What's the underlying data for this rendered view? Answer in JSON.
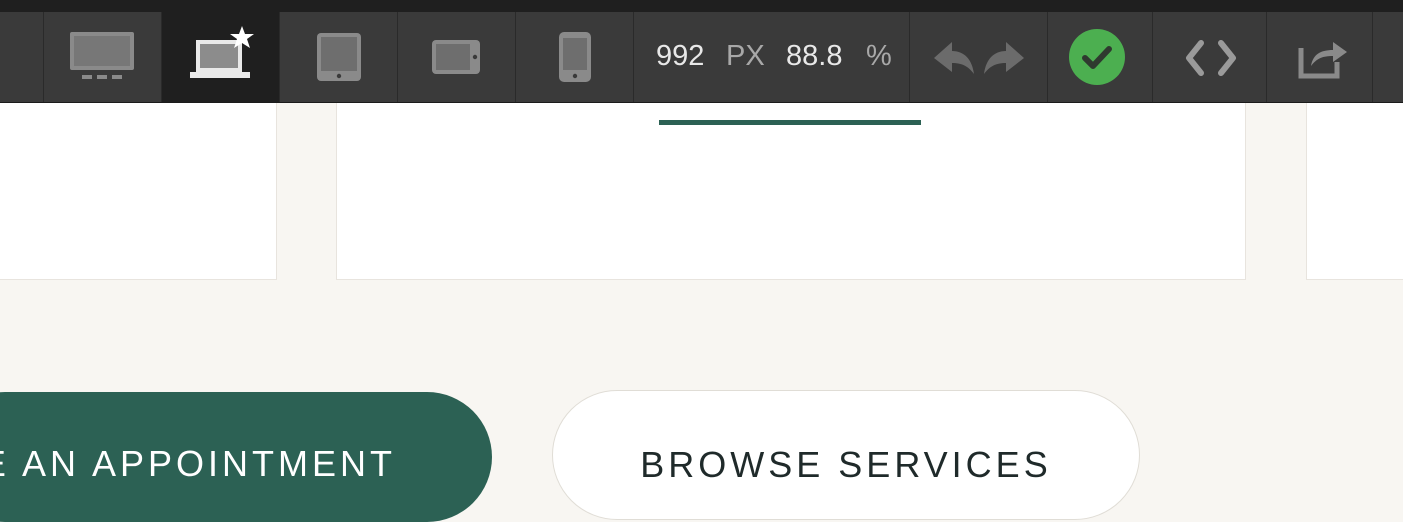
{
  "toolbar": {
    "width_value": "992",
    "width_unit": "PX",
    "zoom_value": "88.8",
    "zoom_unit": "%",
    "status_color": "#4caf50",
    "icons": [
      "desktop-icon",
      "laptop-star-icon",
      "tablet-portrait-icon",
      "tablet-landscape-icon",
      "phone-icon",
      "undo-icon",
      "redo-icon",
      "checkmark-icon",
      "code-icon",
      "share-icon"
    ]
  },
  "canvas": {
    "accent_color": "#2c6154",
    "primary_cta_label": "E AN APPOINTMENT",
    "secondary_cta_label": "BROWSE SERVICES"
  }
}
